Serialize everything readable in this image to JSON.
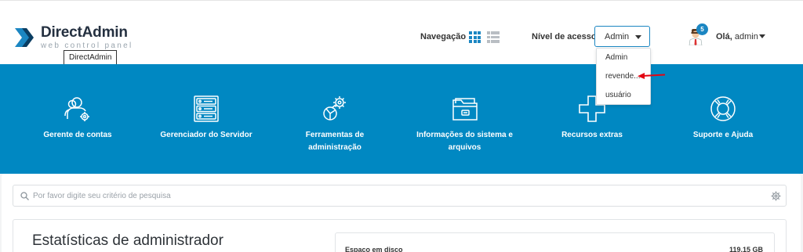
{
  "header": {
    "logo_title": "DirectAdmin",
    "logo_subtitle": "web control panel",
    "logo_tooltip": "DirectAdmin",
    "nav_label": "Navegação",
    "access_label": "Nível de acesso",
    "access_selected": "Admin",
    "access_options": [
      "Admin",
      "revende...",
      "usuário"
    ],
    "notification_count": "5",
    "greeting": "Olá,",
    "username": "admin"
  },
  "categories": [
    {
      "label": "Gerente de contas",
      "icon": "users-gear-icon"
    },
    {
      "label": "Gerenciador do Servidor",
      "icon": "server-rack-icon"
    },
    {
      "label": "Ferramentas de administração",
      "icon": "tools-gear-icon"
    },
    {
      "label": "Informações do sistema e arquivos",
      "icon": "folder-icon"
    },
    {
      "label": "Recursos extras",
      "icon": "plus-icon"
    },
    {
      "label": "Suporte e Ajuda",
      "icon": "lifebuoy-icon"
    }
  ],
  "search": {
    "placeholder": "Por favor digite seu critério de pesquisa"
  },
  "stats": {
    "title": "Estatísticas de administrador",
    "disk_label": "Espaço em disco",
    "disk_value": "119.15 GB"
  },
  "colors": {
    "brand_blue": "#0088c2",
    "accent_blue": "#1b86c2",
    "annotation_red": "#e30613"
  }
}
